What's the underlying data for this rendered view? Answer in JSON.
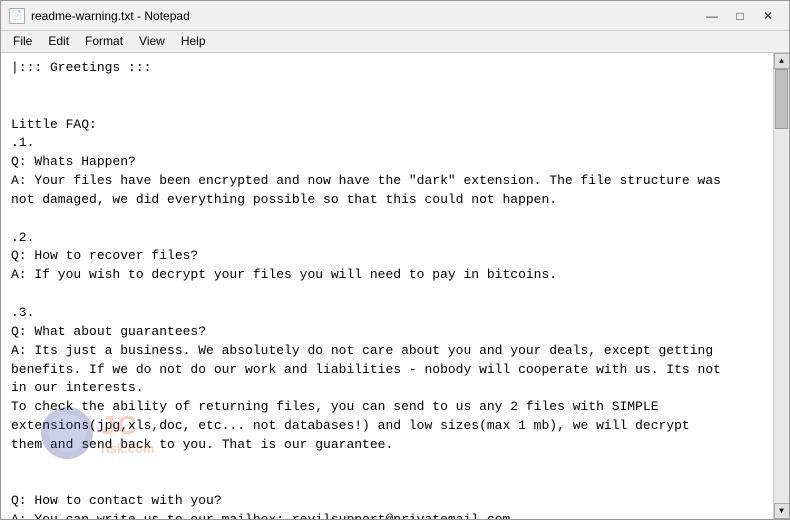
{
  "window": {
    "title": "readme-warning.txt - Notepad",
    "icon": "📄"
  },
  "controls": {
    "minimize": "—",
    "maximize": "□",
    "close": "✕"
  },
  "menu": {
    "items": [
      "File",
      "Edit",
      "Format",
      "View",
      "Help"
    ]
  },
  "content": {
    "text": "|::: Greetings :::\n\n\nLittle FAQ:\n.1.\nQ: Whats Happen?\nA: Your files have been encrypted and now have the \"dark\" extension. The file structure was\nnot damaged, we did everything possible so that this could not happen.\n\n.2.\nQ: How to recover files?\nA: If you wish to decrypt your files you will need to pay in bitcoins.\n\n.3.\nQ: What about guarantees?\nA: Its just a business. We absolutely do not care about you and your deals, except getting\nbenefits. If we do not do our work and liabilities - nobody will cooperate with us. Its not\nin our interests.\nTo check the ability of returning files, you can send to us any 2 files with SIMPLE\nextensions(jpg,xls,doc, etc... not databases!) and low sizes(max 1 mb), we will decrypt\nthem and send back to you. That is our guarantee.\n\n\nQ: How to contact with you?\nA: You can write us to our mailbox: revilsupport@privatemail.com"
  },
  "watermark": {
    "logo_text": "JC",
    "brand_text": "risk.com"
  }
}
